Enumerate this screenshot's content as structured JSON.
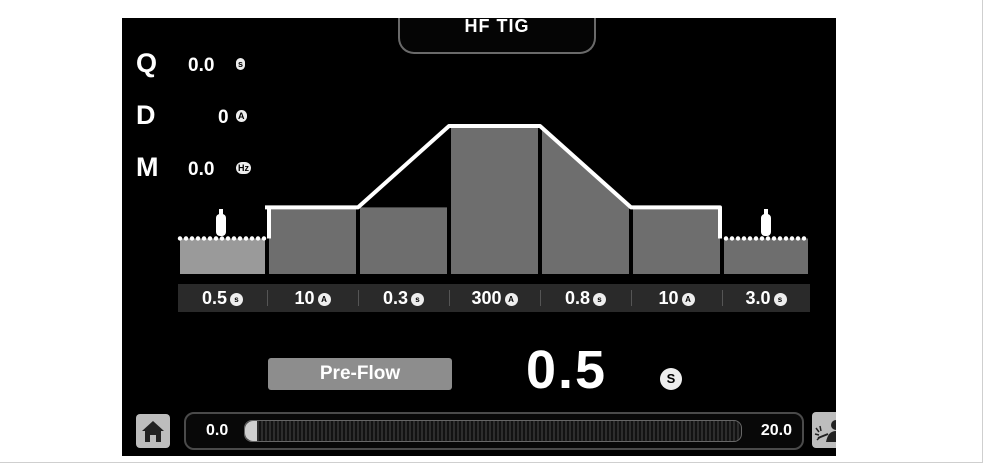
{
  "mode": {
    "label": "HF TIG"
  },
  "params": [
    {
      "letter": "Q",
      "value": "0.0",
      "unit": "s"
    },
    {
      "letter": "D",
      "value": "0",
      "unit": "A"
    },
    {
      "letter": "M",
      "value": "0.0",
      "unit": "Hz"
    }
  ],
  "segments": [
    {
      "value": "0.5",
      "unit": "s",
      "level": 0.24
    },
    {
      "value": "10",
      "unit": "A",
      "level": 0.45
    },
    {
      "value": "0.3",
      "unit": "s",
      "level": 0.45
    },
    {
      "value": "300",
      "unit": "A",
      "level": 1.0
    },
    {
      "value": "0.8",
      "unit": "s",
      "level": 1.0
    },
    {
      "value": "10",
      "unit": "A",
      "level": 0.45
    },
    {
      "value": "3.0",
      "unit": "s",
      "level": 0.24
    }
  ],
  "current_phase": {
    "label": "Pre-Flow",
    "value": "0.5",
    "unit": "S"
  },
  "slider": {
    "min_label": "0.0",
    "max_label": "20.0",
    "min": 0.0,
    "max": 20.0,
    "value": 0.5
  },
  "icons": {
    "home": "home-icon",
    "welder": "welder-icon",
    "gas": "gas-bottle-icon"
  },
  "colors": {
    "screen_bg": "#000000",
    "graph_fill": "#6e6e6e",
    "selected_fill": "#9a9a9a",
    "outline": "#ffffff"
  }
}
